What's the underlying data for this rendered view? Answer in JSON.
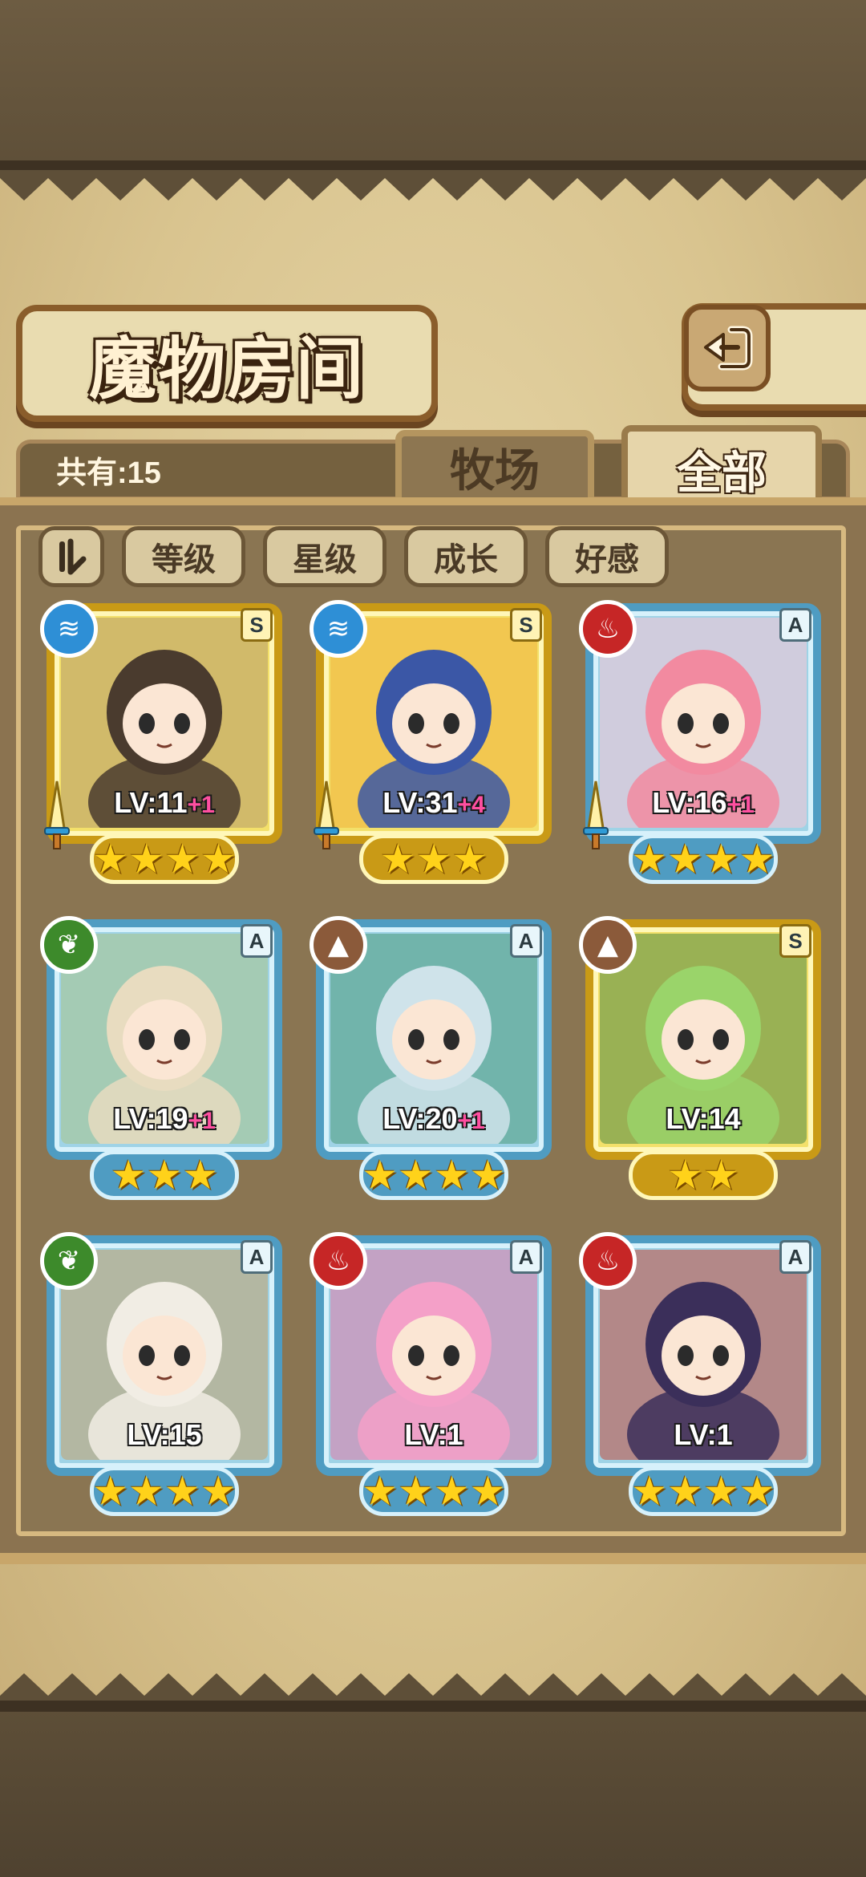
{
  "header": {
    "title": "魔物房间",
    "back_label": "back"
  },
  "count_label": "共有:15",
  "tabs": [
    {
      "label": "牧场",
      "active": false
    },
    {
      "label": "全部",
      "active": true
    }
  ],
  "filters": [
    "等级",
    "星级",
    "成长",
    "好感"
  ],
  "sort_toggle_icon": "sort-order-icon",
  "colors": {
    "blue_frame": "#4f9cc2",
    "gold_frame": "#c99a16",
    "star": "#ffd21a",
    "bonus": "#ff4fa0"
  },
  "monsters": [
    {
      "rank": "S",
      "element": "water",
      "frame": "gold",
      "level": "LV:11",
      "bonus": "+1",
      "stars": 4,
      "equipped": true
    },
    {
      "rank": "S",
      "element": "water",
      "frame": "gold",
      "level": "LV:31",
      "bonus": "+4",
      "stars": 3,
      "equipped": true
    },
    {
      "rank": "A",
      "element": "fire",
      "frame": "blue",
      "level": "LV:16",
      "bonus": "+1",
      "stars": 4,
      "equipped": true
    },
    {
      "rank": "A",
      "element": "wood",
      "frame": "blue",
      "level": "LV:19",
      "bonus": "+1",
      "stars": 3,
      "equipped": false
    },
    {
      "rank": "A",
      "element": "earth",
      "frame": "blue",
      "level": "LV:20",
      "bonus": "+1",
      "stars": 4,
      "equipped": false
    },
    {
      "rank": "S",
      "element": "earth",
      "frame": "gold",
      "level": "LV:14",
      "bonus": "",
      "stars": 2,
      "equipped": false
    },
    {
      "rank": "A",
      "element": "wood",
      "frame": "blue",
      "level": "LV:15",
      "bonus": "",
      "stars": 4,
      "equipped": false
    },
    {
      "rank": "A",
      "element": "fire",
      "frame": "blue",
      "level": "LV:1",
      "bonus": "",
      "stars": 4,
      "equipped": false
    },
    {
      "rank": "A",
      "element": "fire",
      "frame": "blue",
      "level": "LV:1",
      "bonus": "",
      "stars": 4,
      "equipped": false
    }
  ]
}
